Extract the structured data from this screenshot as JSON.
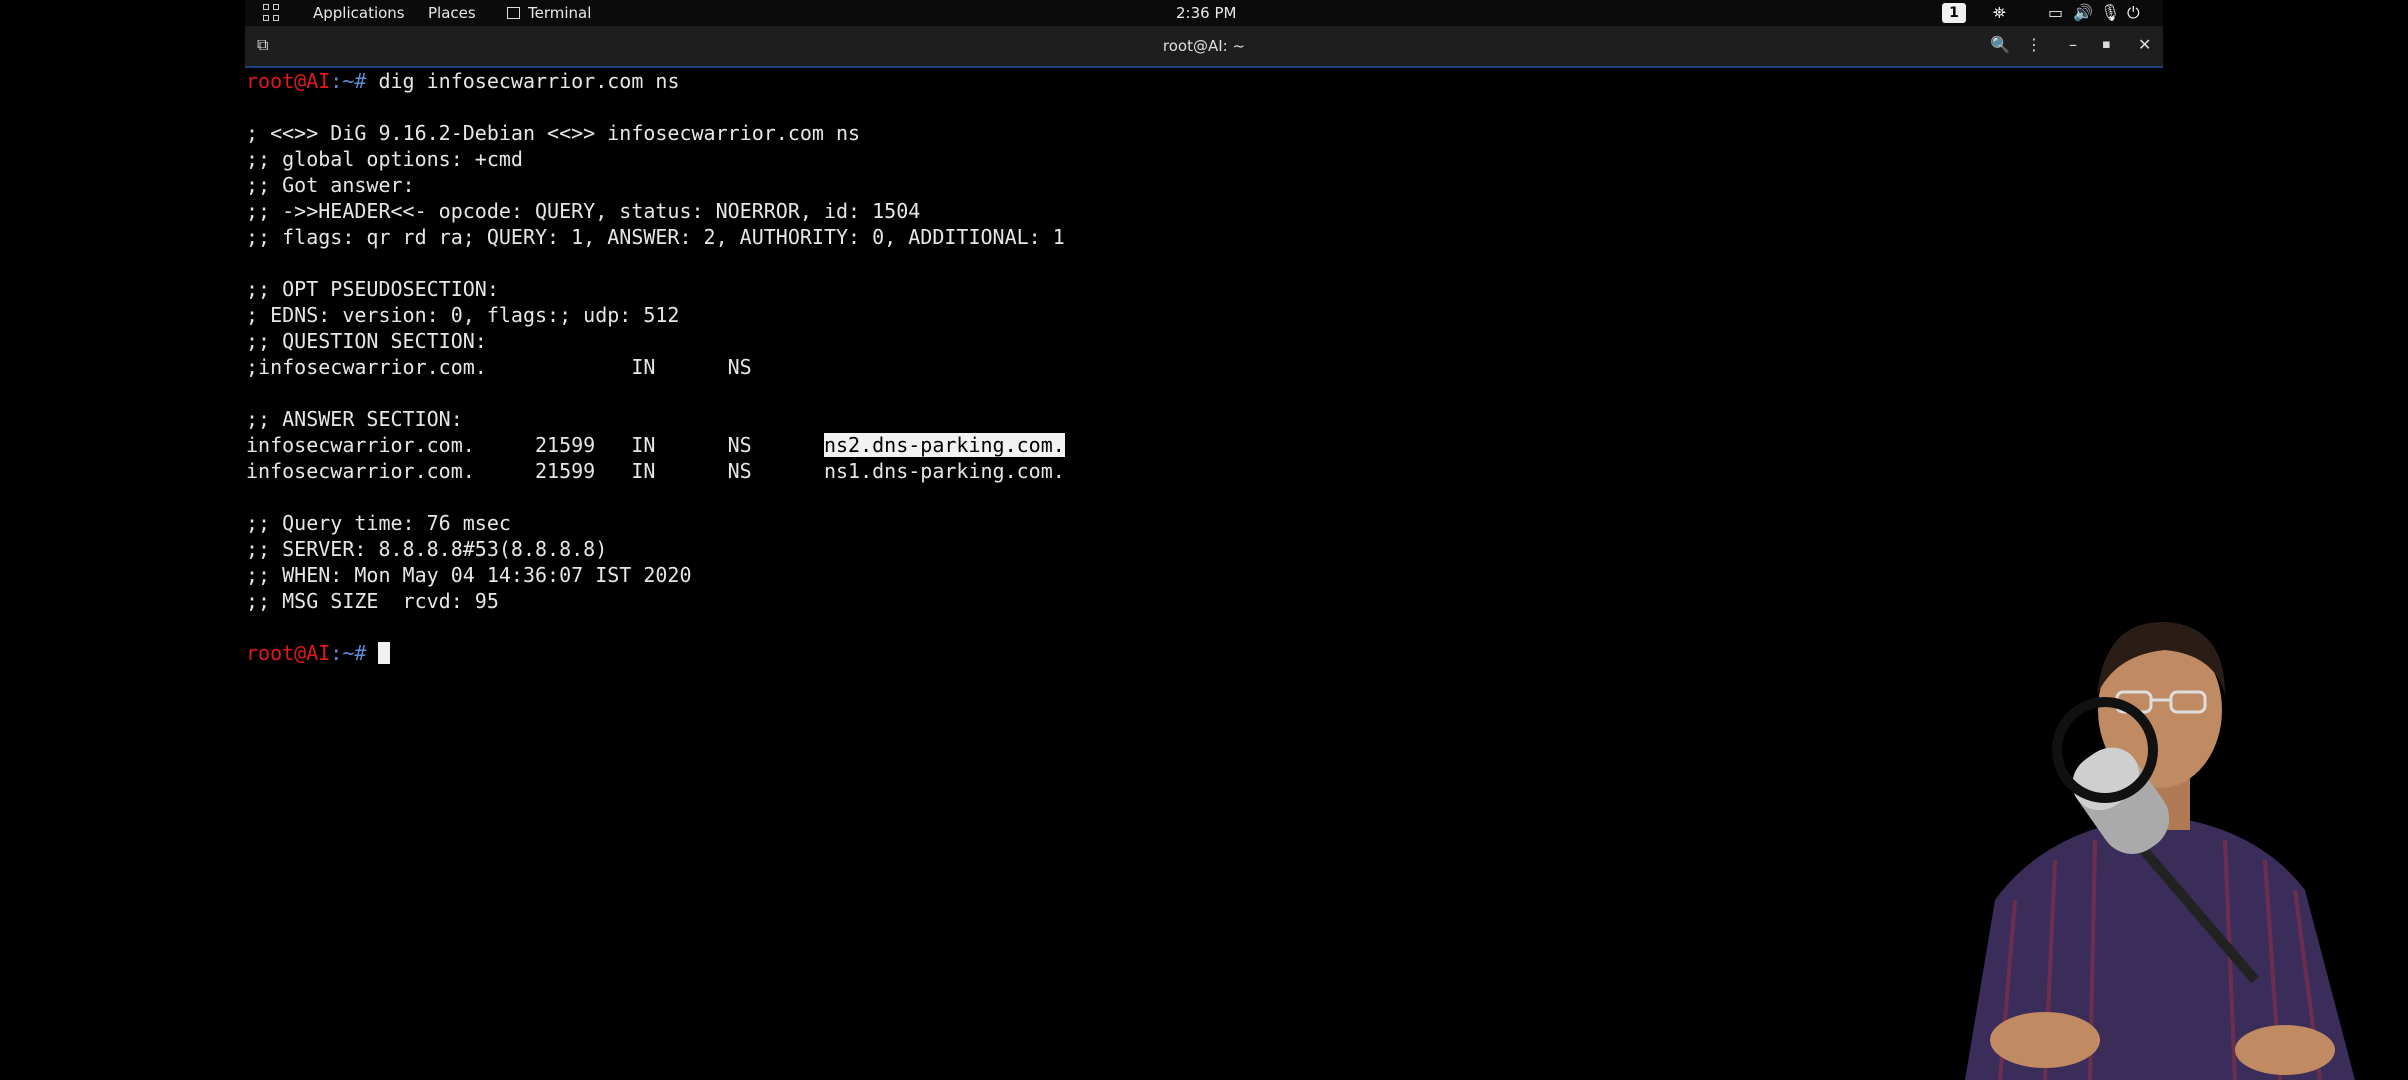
{
  "panel": {
    "applications_label": "Applications",
    "places_label": "Places",
    "terminal_label": "Terminal",
    "clock": "2:36 PM",
    "workspace_number": "1"
  },
  "window": {
    "title": "root@AI: ~"
  },
  "terminal": {
    "prompt_user": "root@AI",
    "prompt_path": ":~#",
    "command": " dig infosecwarrior.com ns",
    "lines": [
      "; <<>> DiG 9.16.2-Debian <<>> infosecwarrior.com ns",
      ";; global options: +cmd",
      ";; Got answer:",
      ";; ->>HEADER<<- opcode: QUERY, status: NOERROR, id: 1504",
      ";; flags: qr rd ra; QUERY: 1, ANSWER: 2, AUTHORITY: 0, ADDITIONAL: 1",
      "",
      ";; OPT PSEUDOSECTION:",
      "; EDNS: version: 0, flags:; udp: 512",
      ";; QUESTION SECTION:",
      ";infosecwarrior.com.            IN      NS",
      "",
      ";; ANSWER SECTION:"
    ],
    "answer1_prefix": "infosecwarrior.com.     21599   IN      NS      ",
    "answer1_highlight": "ns2.dns-parking.com.",
    "answer2": "infosecwarrior.com.     21599   IN      NS      ns1.dns-parking.com.",
    "footer_lines": [
      ";; Query time: 76 msec",
      ";; SERVER: 8.8.8.8#53(8.8.8.8)",
      ";; WHEN: Mon May 04 14:36:07 IST 2020",
      ";; MSG SIZE  rcvd: 95"
    ]
  }
}
